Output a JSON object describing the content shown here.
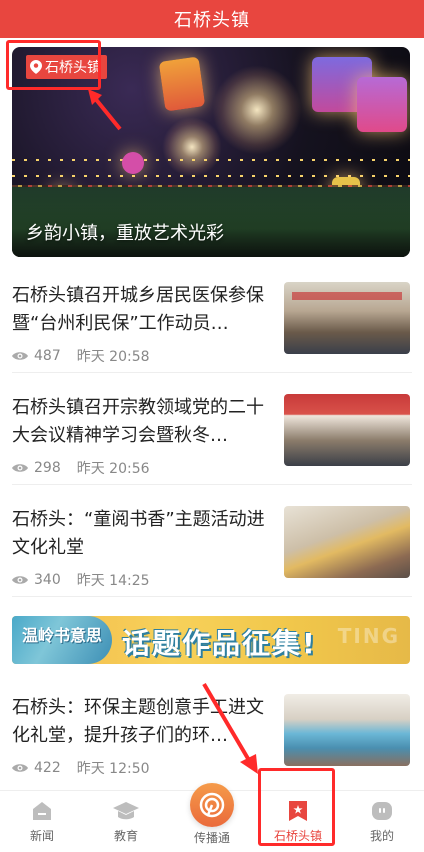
{
  "header": {
    "title": "石桥头镇"
  },
  "hero": {
    "tag": "石桥头镇",
    "caption": "乡韵小镇，重放艺术光彩"
  },
  "news": [
    {
      "headline": "石桥头镇召开城乡居民医保参保暨“台州利民保”工作动员…",
      "views": "487",
      "time": "昨天 20:58"
    },
    {
      "headline": "石桥头镇召开宗教领域党的二十大会议精神学习会暨秋冬…",
      "views": "298",
      "time": "昨天 20:56"
    },
    {
      "headline": "石桥头：“童阅书香”主题活动进文化礼堂",
      "views": "340",
      "time": "昨天 14:25"
    },
    {
      "headline": "石桥头：环保主题创意手工进文化礼堂，提升孩子们的环…",
      "views": "422",
      "time": "昨天 12:50"
    }
  ],
  "banner": {
    "art_text": "温岭书意思",
    "main_text": "话题作品征集!",
    "bg_text": "TING"
  },
  "tabbar": {
    "items": [
      {
        "label": "新闻",
        "icon": "home-icon"
      },
      {
        "label": "教育",
        "icon": "graduation-cap-icon"
      },
      {
        "label": "传播通",
        "icon": "broadcast-icon"
      },
      {
        "label": "石桥头镇",
        "icon": "bookmark-star-icon"
      },
      {
        "label": "我的",
        "icon": "profile-icon"
      }
    ],
    "active_index": 3
  },
  "colors": {
    "brand_red": "#e8463f",
    "highlight_red": "#ff2a2a",
    "meta_gray": "#888888"
  }
}
